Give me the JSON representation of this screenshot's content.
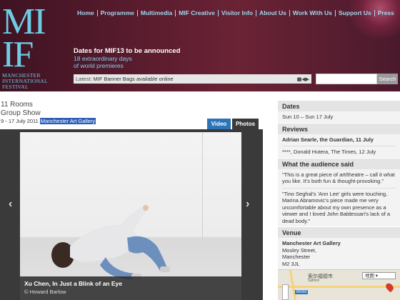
{
  "logo": {
    "mark_top": "MI",
    "mark_bottom": "IF",
    "name_lines": [
      "MANCHESTER",
      "INTERNATIONAL",
      "FESTIVAL"
    ]
  },
  "nav": [
    "Home",
    "Programme",
    "Multimedia",
    "MIF Creative",
    "Visitor Info",
    "About Us",
    "Work With Us",
    "Support Us",
    "Press"
  ],
  "promo": {
    "headline": "Dates for MIF13 to be announced",
    "sub1": "18 extraordinary days",
    "sub2": "of world premieres"
  },
  "ticker": {
    "label": "Latest:",
    "message": "MIF Banner Bags available online",
    "controls": "▮▮ ◀ ▶"
  },
  "search": {
    "placeholder": "",
    "button": "Search"
  },
  "event": {
    "title1": "11 Rooms",
    "title2": "Group Show",
    "dates": "9 - 17 July 2011",
    "venue_link": "Manchester Art Gallery"
  },
  "tabs": {
    "video": "Video",
    "photos": "Photos"
  },
  "photo": {
    "caption_title": "Xu Chen, In Just a Blink of an Eye",
    "credit": "© Howard Barlow",
    "prev": "‹",
    "next": "›"
  },
  "sidebar": {
    "dates_h": "Dates",
    "dates": "Sun 10 – Sun 17 July",
    "reviews_h": "Reviews",
    "review1": "Adrian Searle, the Guardian, 11 July",
    "review2": "****, Donald Hutera, The Times, 12 July",
    "audience_h": "What the audience said",
    "quote1": "\"This is a great piece of art/theatre – call it what you like. It's both fun & thought-provoking.\"",
    "quote2": "\"Tino Seghal's 'Ann Lee' girls were touching, Marina Abramovic's piece made me very uncomfortable about my own presence as a viewer and I loved John Baldessari's lack of a dead body.\"",
    "venue_h": "Venue",
    "venue_name": "Manchester Art Gallery",
    "venue_addr1": "Mosley Street,",
    "venue_addr2": "Manchester",
    "venue_addr3": "M2 3JL"
  },
  "map": {
    "label": "索尔福德市",
    "sublabel": "Salford",
    "select": "地图 ▾",
    "badge": "B6093"
  },
  "colors": {
    "header_bg": "#5a1c2e",
    "logo": "#6ecbe6",
    "nav_link": "#9fd8ee",
    "tab_active": "#2c74b8",
    "tab_inactive": "#3a3a3a"
  }
}
